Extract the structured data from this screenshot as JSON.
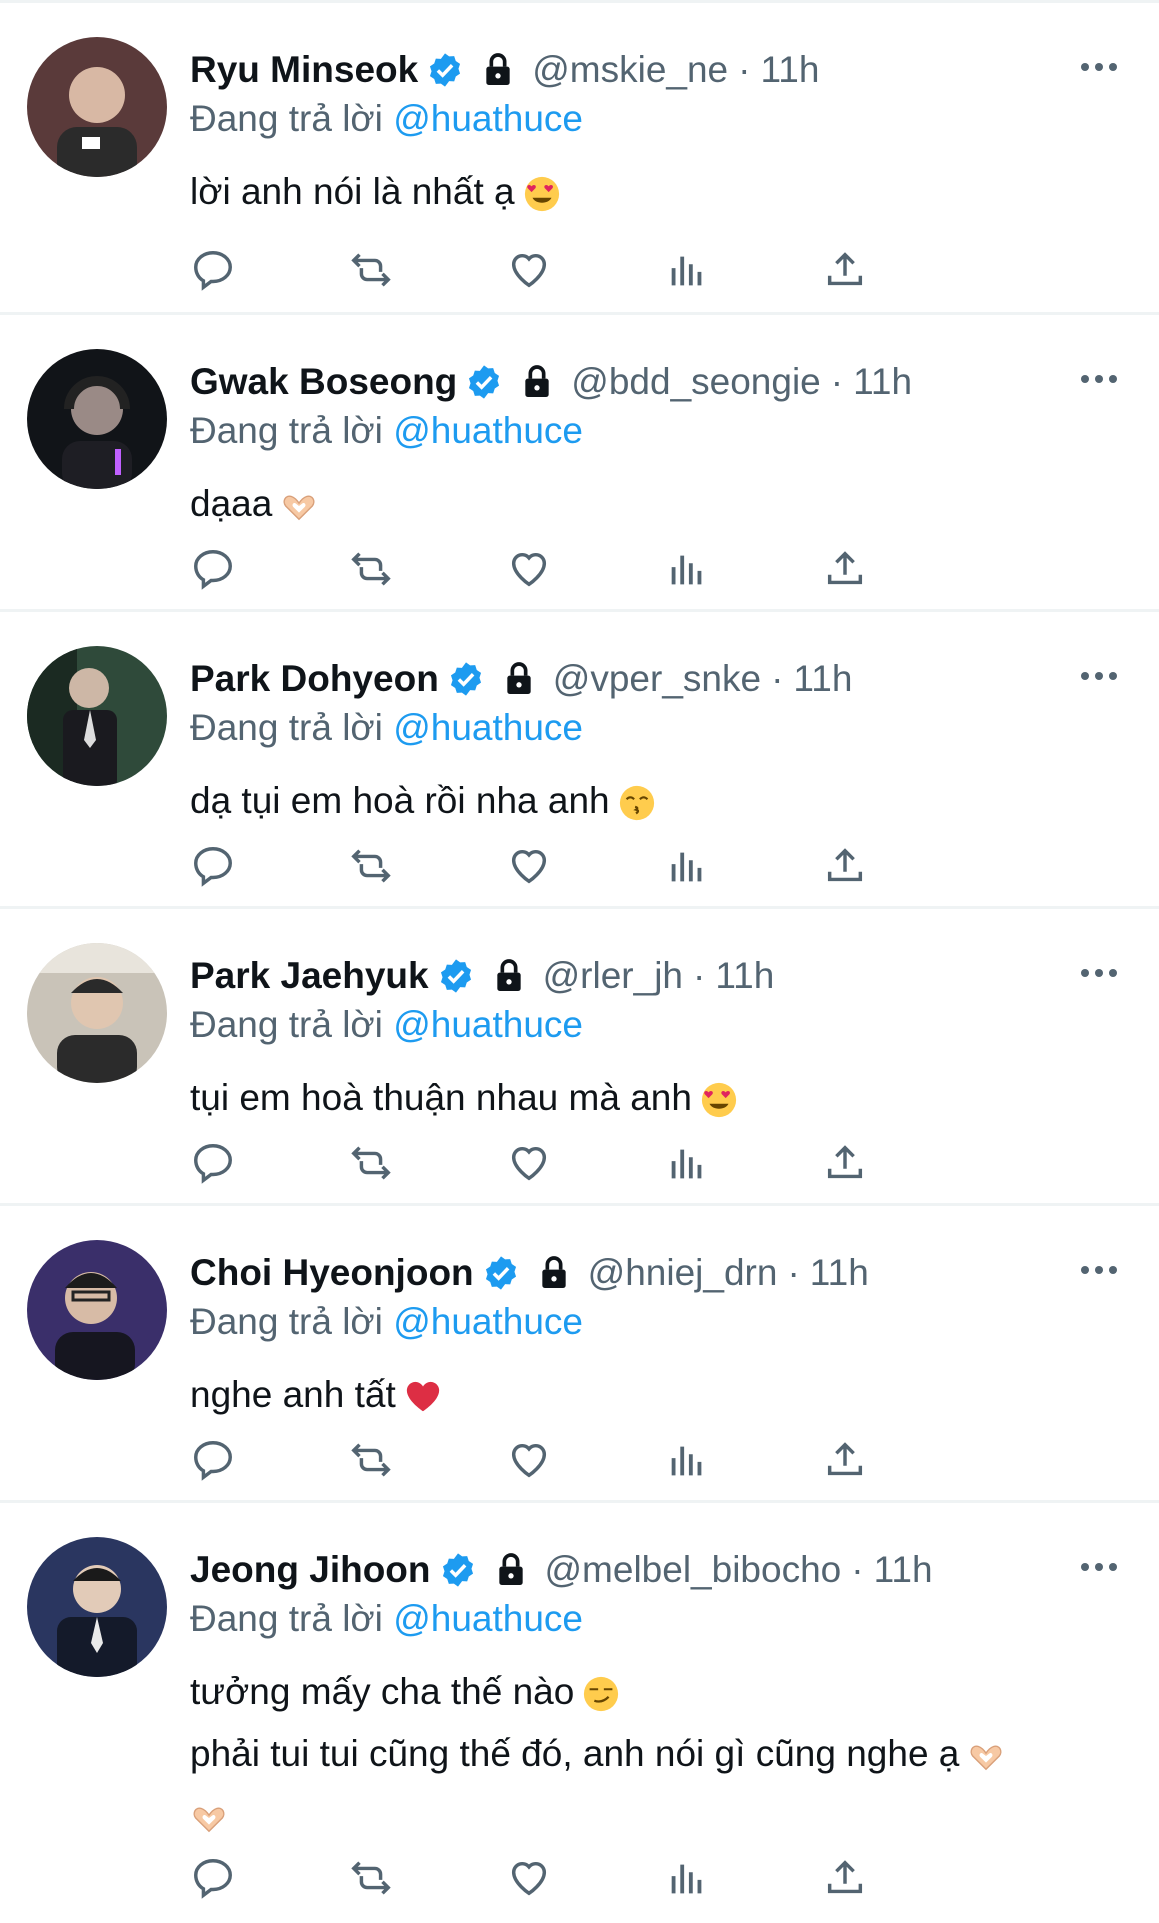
{
  "colors": {
    "accent": "#1d9bf0",
    "secondary_text": "#536471",
    "divider": "#eff3f4",
    "icon": "#536471"
  },
  "replying_prefix": "Đang trả lời",
  "tweets": [
    {
      "name": "Ryu Minseok",
      "handle": "@mskie_ne",
      "time": "11h",
      "mention": "@huathuce",
      "lines": [
        "lời anh nói là nhất ạ"
      ],
      "emojis": [
        "heart-eyes-emoji"
      ]
    },
    {
      "name": "Gwak Boseong",
      "handle": "@bdd_seongie",
      "time": "11h",
      "mention": "@huathuce",
      "lines": [
        "dạaa"
      ],
      "emojis": [
        "heart-hands-emoji"
      ]
    },
    {
      "name": "Park Dohyeon",
      "handle": "@vper_snke",
      "time": "11h",
      "mention": "@huathuce",
      "lines": [
        "dạ tụi em hoà rồi nha anh"
      ],
      "emojis": [
        "kissing-face-emoji"
      ]
    },
    {
      "name": "Park Jaehyuk",
      "handle": "@rler_jh",
      "time": "11h",
      "mention": "@huathuce",
      "lines": [
        "tụi em hoà thuận nhau mà anh"
      ],
      "emojis": [
        "heart-eyes-emoji"
      ]
    },
    {
      "name": "Choi Hyeonjoon",
      "handle": "@hniej_drn",
      "time": "11h",
      "mention": "@huathuce",
      "lines": [
        "nghe anh tất"
      ],
      "emojis": [
        "red-heart-emoji"
      ]
    },
    {
      "name": "Jeong Jihoon",
      "handle": "@melbel_bibocho",
      "time": "11h",
      "mention": "@huathuce",
      "lines": [
        "tưởng mấy cha thế nào",
        "phải tui tui cũng thế đó, anh nói gì cũng nghe ạ"
      ],
      "emojis": [
        "smirking-face-emoji",
        "heart-hands-emoji",
        "heart-hands-emoji"
      ]
    }
  ],
  "actions": [
    "reply",
    "retweet",
    "like",
    "views",
    "share"
  ]
}
